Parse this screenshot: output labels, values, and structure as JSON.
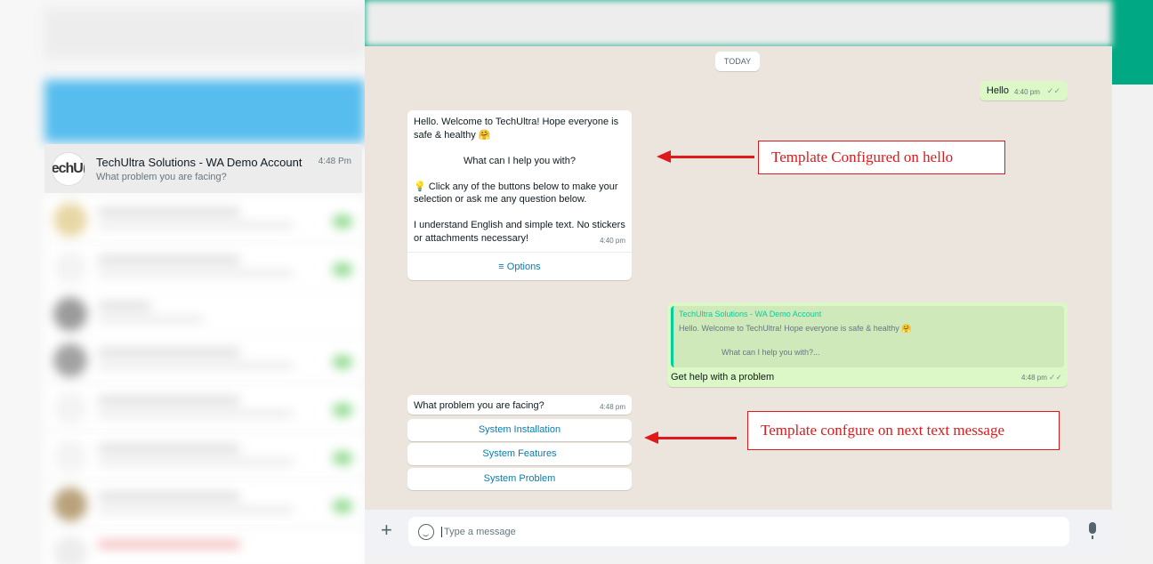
{
  "chat_list": {
    "active_chat": {
      "avatar_text": "echUl",
      "name": "TechUltra Solutions - WA Demo Account",
      "last_message": "What problem you are facing?",
      "time": "4:48 Pm"
    }
  },
  "conversation": {
    "date_divider": "TODAY",
    "outgoing_hello": {
      "text": "Hello",
      "time": "4:40 pm",
      "ticks": "✓✓"
    },
    "welcome": {
      "line1": "Hello. Welcome to TechUltra! Hope everyone is safe & healthy 🤗",
      "line2": "What can I help you with?",
      "line3": "💡 Click any of the buttons below to make your selection or ask me any question below.",
      "line4": "I understand English and simple text. No stickers or attachments necessary!",
      "time": "4:40 pm",
      "options_label": "≡  Options"
    },
    "reply": {
      "quote_name": "TechUltra Solutions - WA Demo Account",
      "quote_text": "Hello. Welcome to TechUltra! Hope everyone is safe & healthy 🤗",
      "quote_text2": "What can I help you with?...",
      "text": "Get help with a problem",
      "time": "4:48 pm",
      "ticks": "✓✓"
    },
    "problem": {
      "text": "What problem you are facing?",
      "time": "4:48 pm",
      "buttons": [
        "System Installation",
        "System Features",
        "System Problem"
      ]
    }
  },
  "composer": {
    "placeholder": "Type a message",
    "plus": "+"
  },
  "annotations": {
    "first": "Template Configured on hello",
    "second": "Template confgure on next text message"
  }
}
